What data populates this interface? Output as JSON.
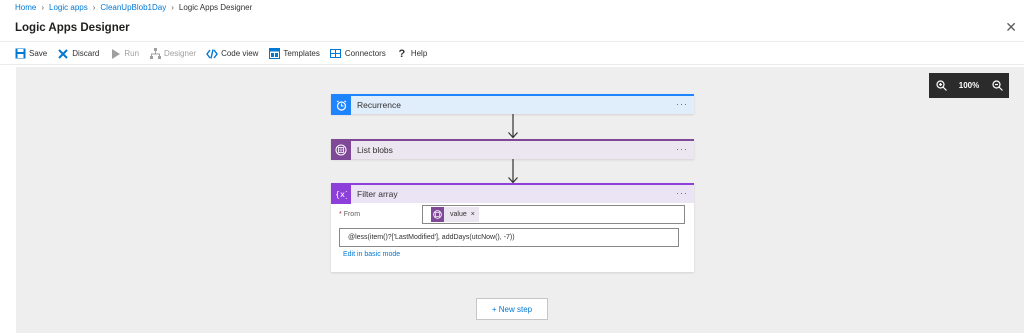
{
  "breadcrumb": {
    "items": [
      "Home",
      "Logic apps",
      "CleanUpBlob1Day"
    ],
    "current": "Logic Apps Designer"
  },
  "window": {
    "title": "Logic Apps Designer",
    "close_glyph": "✕"
  },
  "toolbar": {
    "save": "Save",
    "discard": "Discard",
    "run": "Run",
    "designer": "Designer",
    "code_view": "Code view",
    "templates": "Templates",
    "connectors": "Connectors",
    "help": "Help"
  },
  "zoom": {
    "level": "100%",
    "zoom_in_icon": "zoom-in-icon",
    "zoom_out_icon": "zoom-out-icon"
  },
  "steps": [
    {
      "title": "Recurrence",
      "icon": "alarm-clock-icon",
      "color": "#1f85ff"
    },
    {
      "title": "List blobs",
      "icon": "blob-storage-icon",
      "color": "#804998"
    },
    {
      "title": "Filter array",
      "icon": "variables-icon",
      "color": "#8c3fd9"
    }
  ],
  "filter": {
    "from_label": "From",
    "required_mark": "*",
    "token_label": "value",
    "token_remove": "×",
    "expression": "@less(item()?['LastModified'], addDays(utcNow(), -7))",
    "edit_link": "Edit in basic mode"
  },
  "more_glyph": "···",
  "new_step": "+ New step",
  "colors": {
    "accent": "#0078d4",
    "canvas": "#efeeee",
    "zoom_bg": "#2b2b2b"
  }
}
